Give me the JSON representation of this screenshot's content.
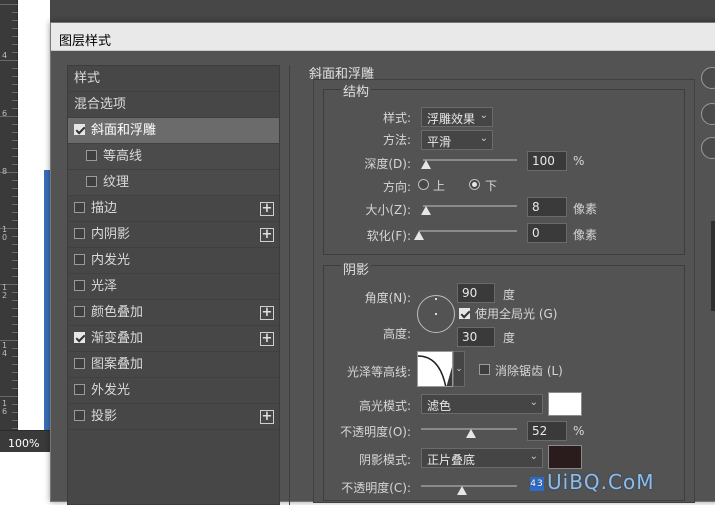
{
  "canvas": {
    "zoom": "100%",
    "ruler_numbers": [
      "4",
      "6",
      "8",
      "1\n0",
      "1\n2",
      "1\n4",
      "1\n6"
    ]
  },
  "dialog": {
    "title": "图层样式",
    "style_list": {
      "header_styles": "样式",
      "header_blending": "混合选项",
      "items": [
        {
          "label": "斜面和浮雕",
          "checked": true,
          "selected": true,
          "sub": false,
          "plus": false
        },
        {
          "label": "等高线",
          "checked": false,
          "selected": false,
          "sub": true,
          "plus": false
        },
        {
          "label": "纹理",
          "checked": false,
          "selected": false,
          "sub": true,
          "plus": false
        },
        {
          "label": "描边",
          "checked": false,
          "selected": false,
          "sub": false,
          "plus": true
        },
        {
          "label": "内阴影",
          "checked": false,
          "selected": false,
          "sub": false,
          "plus": true
        },
        {
          "label": "内发光",
          "checked": false,
          "selected": false,
          "sub": false,
          "plus": false
        },
        {
          "label": "光泽",
          "checked": false,
          "selected": false,
          "sub": false,
          "plus": false
        },
        {
          "label": "颜色叠加",
          "checked": false,
          "selected": false,
          "sub": false,
          "plus": true
        },
        {
          "label": "渐变叠加",
          "checked": true,
          "selected": false,
          "sub": false,
          "plus": true
        },
        {
          "label": "图案叠加",
          "checked": false,
          "selected": false,
          "sub": false,
          "plus": false
        },
        {
          "label": "外发光",
          "checked": false,
          "selected": false,
          "sub": false,
          "plus": false
        },
        {
          "label": "投影",
          "checked": false,
          "selected": false,
          "sub": false,
          "plus": true
        }
      ]
    },
    "bevel": {
      "section_title": "斜面和浮雕",
      "structure": {
        "title": "结构",
        "style_label": "样式:",
        "style_value": "浮雕效果",
        "technique_label": "方法:",
        "technique_value": "平滑",
        "depth_label": "深度(D):",
        "depth_value": "100",
        "depth_unit": "%",
        "depth_level": 0.03,
        "direction_label": "方向:",
        "direction_up": "上",
        "direction_down": "下",
        "direction_selected": "下",
        "size_label": "大小(Z):",
        "size_value": "8",
        "size_unit": "像素",
        "size_level": 0.03,
        "soften_label": "软化(F):",
        "soften_value": "0",
        "soften_unit": "像素",
        "soften_level": 0.0
      },
      "shading": {
        "title": "阴影",
        "angle_label": "角度(N):",
        "angle_value": "90",
        "angle_unit": "度",
        "global_light_label": "使用全局光 (G)",
        "global_light_checked": true,
        "altitude_label": "高度:",
        "altitude_value": "30",
        "altitude_unit": "度",
        "gloss_contour_label": "光泽等高线:",
        "antialias_label": "消除锯齿 (L)",
        "antialias_checked": false,
        "highlight_mode_label": "高光模式:",
        "highlight_mode_value": "滤色",
        "highlight_color": "#ffffff",
        "highlight_opacity_label": "不透明度(O):",
        "highlight_opacity_value": "52",
        "highlight_opacity_unit": "%",
        "highlight_opacity_level": 0.52,
        "shadow_mode_label": "阴影模式:",
        "shadow_mode_value": "正片叠底",
        "shadow_color": "#2a1c1c",
        "shadow_opacity_label": "不透明度(C):",
        "shadow_opacity_value": "43",
        "shadow_opacity_level": 0.43
      }
    }
  },
  "watermark": {
    "badge": "43",
    "text": "UiBQ.CoM"
  }
}
